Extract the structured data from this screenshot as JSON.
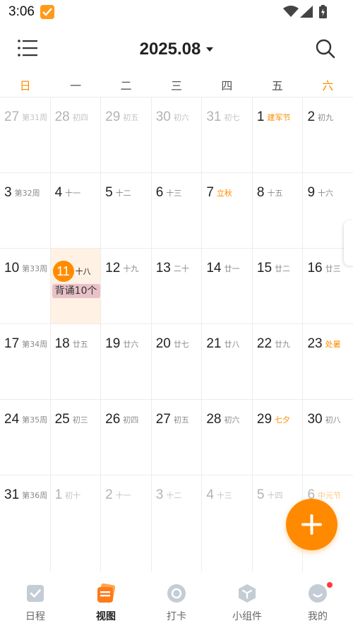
{
  "status_bar": {
    "time": "3:06"
  },
  "header": {
    "month": "2025.08"
  },
  "weekdays": [
    "日",
    "一",
    "二",
    "三",
    "四",
    "五",
    "六"
  ],
  "calendar": {
    "weeks": [
      [
        {
          "day": "27",
          "sub": "第31周",
          "other": true
        },
        {
          "day": "28",
          "sub": "初四",
          "other": true
        },
        {
          "day": "29",
          "sub": "初五",
          "other": true
        },
        {
          "day": "30",
          "sub": "初六",
          "other": true
        },
        {
          "day": "31",
          "sub": "初七",
          "other": true
        },
        {
          "day": "1",
          "sub": "建军节",
          "festival": true
        },
        {
          "day": "2",
          "sub": "初九"
        }
      ],
      [
        {
          "day": "3",
          "sub": "第32周"
        },
        {
          "day": "4",
          "sub": "十一"
        },
        {
          "day": "5",
          "sub": "十二"
        },
        {
          "day": "6",
          "sub": "十三"
        },
        {
          "day": "7",
          "sub": "立秋",
          "festival": true
        },
        {
          "day": "8",
          "sub": "十五"
        },
        {
          "day": "9",
          "sub": "十六"
        }
      ],
      [
        {
          "day": "10",
          "sub": "第33周"
        },
        {
          "day": "11",
          "sub": "十八",
          "today": true,
          "event": "背诵10个"
        },
        {
          "day": "12",
          "sub": "十九"
        },
        {
          "day": "13",
          "sub": "二十"
        },
        {
          "day": "14",
          "sub": "廿一"
        },
        {
          "day": "15",
          "sub": "廿二"
        },
        {
          "day": "16",
          "sub": "廿三"
        }
      ],
      [
        {
          "day": "17",
          "sub": "第34周"
        },
        {
          "day": "18",
          "sub": "廿五"
        },
        {
          "day": "19",
          "sub": "廿六"
        },
        {
          "day": "20",
          "sub": "廿七"
        },
        {
          "day": "21",
          "sub": "廿八"
        },
        {
          "day": "22",
          "sub": "廿九"
        },
        {
          "day": "23",
          "sub": "处暑",
          "festival": true
        }
      ],
      [
        {
          "day": "24",
          "sub": "第35周"
        },
        {
          "day": "25",
          "sub": "初三"
        },
        {
          "day": "26",
          "sub": "初四"
        },
        {
          "day": "27",
          "sub": "初五"
        },
        {
          "day": "28",
          "sub": "初六"
        },
        {
          "day": "29",
          "sub": "七夕",
          "festival": true
        },
        {
          "day": "30",
          "sub": "初八"
        }
      ],
      [
        {
          "day": "31",
          "sub": "第36周"
        },
        {
          "day": "1",
          "sub": "初十",
          "other": true
        },
        {
          "day": "2",
          "sub": "十一",
          "other": true
        },
        {
          "day": "3",
          "sub": "十二",
          "other": true
        },
        {
          "day": "4",
          "sub": "十三",
          "other": true
        },
        {
          "day": "5",
          "sub": "十四",
          "other": true
        },
        {
          "day": "6",
          "sub": "中元节",
          "other": true,
          "festival": true
        }
      ]
    ]
  },
  "bottom_nav": [
    {
      "label": "日程",
      "icon": "schedule-icon"
    },
    {
      "label": "视图",
      "icon": "view-icon",
      "active": true
    },
    {
      "label": "打卡",
      "icon": "checkin-icon"
    },
    {
      "label": "小组件",
      "icon": "widget-icon"
    },
    {
      "label": "我的",
      "icon": "profile-icon",
      "badge": true
    }
  ],
  "colors": {
    "accent": "#ff8c00",
    "today_bg": "#fff1e3",
    "event_chip": "#e9c1c8",
    "badge": "#ff3a3a"
  }
}
